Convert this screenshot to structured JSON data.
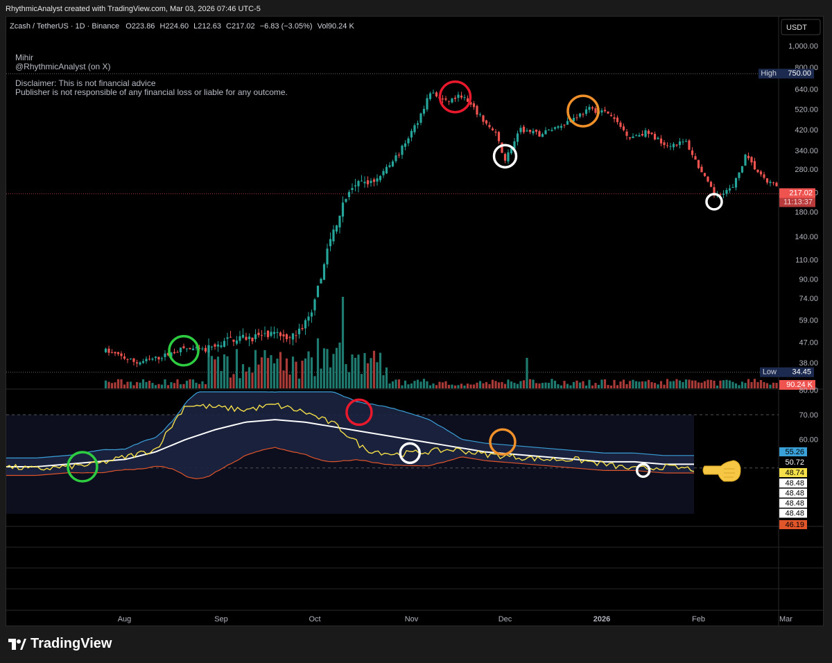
{
  "header": {
    "created": "RhythmicAnalyst created with TradingView.com, Mar 03, 2026 07:46 UTC-5"
  },
  "legend": {
    "symbol": "Zcash / TetherUS · 1D · Binance",
    "o_label": "O",
    "o": "223.86",
    "h_label": "H",
    "h": "224.60",
    "l_label": "L",
    "l": "212.63",
    "c_label": "C",
    "c": "217.02",
    "change": "−6.83 (−3.05%)",
    "vol_label": "Vol",
    "vol": "90.24 K"
  },
  "watermark": {
    "author": "Mihir",
    "handle": "@RhythmicAnalyst (on X)",
    "disclaimer1": "Disclaimer: This is not financial advice",
    "disclaimer2": "Publisher is not responsible of any financial loss or liable for any outcome."
  },
  "currency_button": "USDT",
  "brand": "TradingView",
  "colors": {
    "up": "#26a69a",
    "down": "#ef5350",
    "rsi": "#f5e04a",
    "rsi_ma": "#ffffff",
    "bb_upper": "#3aa0d8",
    "bb_lower": "#e0552a",
    "bb_fill": "#1b2440",
    "circle_green": "#2ecc40",
    "circle_red": "#e8192c",
    "circle_white": "#ffffff",
    "circle_orange": "#f0902a"
  },
  "chart_data": [
    {
      "type": "candlestick",
      "title": "Zcash / TetherUS · 1D · Binance",
      "y_scale": "log",
      "ylim": [
        34.45,
        1000
      ],
      "y_ticks": [
        "1,000.00",
        "800.00",
        "640.00",
        "520.00",
        "420.00",
        "340.00",
        "280.00",
        "220.00",
        "180.00",
        "140.00",
        "110.00",
        "90.00",
        "74.00",
        "59.00",
        "47.00",
        "38.00"
      ],
      "x_ticks": [
        "Aug",
        "Sep",
        "Oct",
        "Nov",
        "Dec",
        "2026",
        "Feb",
        "Mar"
      ],
      "price_path": [
        {
          "x": "2025-07-26",
          "y": 43
        },
        {
          "x": "2025-08-05",
          "y": 38
        },
        {
          "x": "2025-08-12",
          "y": 40
        },
        {
          "x": "2025-08-20",
          "y": 44
        },
        {
          "x": "2025-08-27",
          "y": 43
        },
        {
          "x": "2025-09-05",
          "y": 49
        },
        {
          "x": "2025-09-15",
          "y": 50
        },
        {
          "x": "2025-09-25",
          "y": 51
        },
        {
          "x": "2025-09-30",
          "y": 62
        },
        {
          "x": "2025-10-05",
          "y": 120
        },
        {
          "x": "2025-10-10",
          "y": 200
        },
        {
          "x": "2025-10-15",
          "y": 240
        },
        {
          "x": "2025-10-20",
          "y": 250
        },
        {
          "x": "2025-10-28",
          "y": 330
        },
        {
          "x": "2025-11-03",
          "y": 460
        },
        {
          "x": "2025-11-07",
          "y": 620
        },
        {
          "x": "2025-11-12",
          "y": 560
        },
        {
          "x": "2025-11-17",
          "y": 600
        },
        {
          "x": "2025-11-22",
          "y": 500
        },
        {
          "x": "2025-11-28",
          "y": 400
        },
        {
          "x": "2025-12-01",
          "y": 310
        },
        {
          "x": "2025-12-06",
          "y": 420
        },
        {
          "x": "2025-12-12",
          "y": 400
        },
        {
          "x": "2025-12-20",
          "y": 450
        },
        {
          "x": "2025-12-28",
          "y": 520
        },
        {
          "x": "2026-01-03",
          "y": 500
        },
        {
          "x": "2026-01-10",
          "y": 390
        },
        {
          "x": "2026-01-15",
          "y": 410
        },
        {
          "x": "2026-01-22",
          "y": 360
        },
        {
          "x": "2026-01-28",
          "y": 370
        },
        {
          "x": "2026-02-02",
          "y": 270
        },
        {
          "x": "2026-02-06",
          "y": 215
        },
        {
          "x": "2026-02-12",
          "y": 230
        },
        {
          "x": "2026-02-16",
          "y": 320
        },
        {
          "x": "2026-02-22",
          "y": 250
        },
        {
          "x": "2026-03-03",
          "y": 217
        }
      ],
      "labels": {
        "high": "High",
        "high_value": "750.00",
        "low": "Low",
        "low_value": "34.45",
        "last": "217.02",
        "countdown": "11:13:37",
        "volume": "90.24 K"
      }
    },
    {
      "type": "line",
      "title": "RSI with Bollinger Bands",
      "ylim": [
        40,
        80
      ],
      "y_ticks": [
        "80.00",
        "70.00",
        "60.00"
      ],
      "series": [
        {
          "values": [
            49,
            48,
            49,
            50,
            53,
            56,
            74,
            73,
            72,
            74,
            71,
            66,
            56,
            54,
            55,
            56,
            54,
            53,
            52,
            52,
            50,
            48,
            49,
            48
          ]
        },
        {
          "values": [
            49,
            49,
            50,
            51,
            52,
            55,
            60,
            64,
            67,
            68,
            67,
            65,
            63,
            61,
            59,
            57,
            55,
            54,
            53,
            52,
            51,
            51,
            50,
            50
          ]
        }
      ],
      "labels": {
        "upper": "55.26",
        "ma": "50.72",
        "rsi": "48.74",
        "flat": [
          "48.48",
          "48.48",
          "48.48",
          "48.48"
        ],
        "lower": "46.19"
      }
    }
  ]
}
